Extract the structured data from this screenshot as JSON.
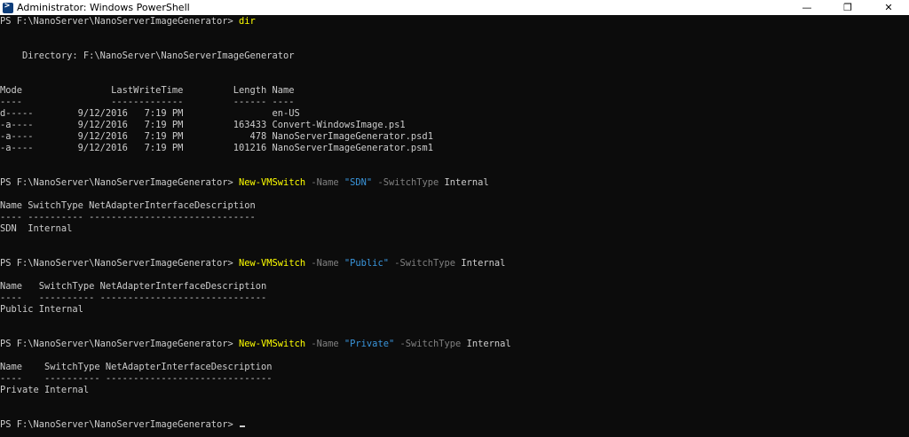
{
  "window": {
    "title": "Administrator: Windows PowerShell",
    "controls": {
      "minimize": "—",
      "restore": "❐",
      "close": "✕"
    }
  },
  "colors": {
    "background": "#0c0c0c",
    "text": "#cccccc",
    "command": "#ffff00",
    "parameter": "#808080",
    "string": "#3a96dd"
  },
  "console": {
    "prompt": "PS F:\\NanoServer\\NanoServerImageGenerator>",
    "cmd1": "dir",
    "directory_line": "    Directory: F:\\NanoServer\\NanoServerImageGenerator",
    "dir_header": "Mode                LastWriteTime         Length Name",
    "dir_sep": "----                -------------         ------ ----",
    "dir_rows": [
      "d-----        9/12/2016   7:19 PM                en-US",
      "-a----        9/12/2016   7:19 PM         163433 Convert-WindowsImage.ps1",
      "-a----        9/12/2016   7:19 PM            478 NanoServerImageGenerator.psd1",
      "-a----        9/12/2016   7:19 PM         101216 NanoServerImageGenerator.psm1"
    ],
    "sdn": {
      "cmdlet": "New-VMSwitch",
      "p_name": "-Name",
      "name": "\"SDN\"",
      "p_type": "-SwitchType",
      "type": "Internal",
      "header": "Name SwitchType NetAdapterInterfaceDescription",
      "sep": "---- ---------- ------------------------------",
      "row": "SDN  Internal"
    },
    "public": {
      "cmdlet": "New-VMSwitch",
      "p_name": "-Name",
      "name": "\"Public\"",
      "p_type": "-SwitchType",
      "type": "Internal",
      "header": "Name   SwitchType NetAdapterInterfaceDescription",
      "sep": "----   ---------- ------------------------------",
      "row": "Public Internal"
    },
    "private": {
      "cmdlet": "New-VMSwitch",
      "p_name": "-Name",
      "name": "\"Private\"",
      "p_type": "-SwitchType",
      "type": "Internal",
      "header": "Name    SwitchType NetAdapterInterfaceDescription",
      "sep": "----    ---------- ------------------------------",
      "row": "Private Internal"
    }
  }
}
